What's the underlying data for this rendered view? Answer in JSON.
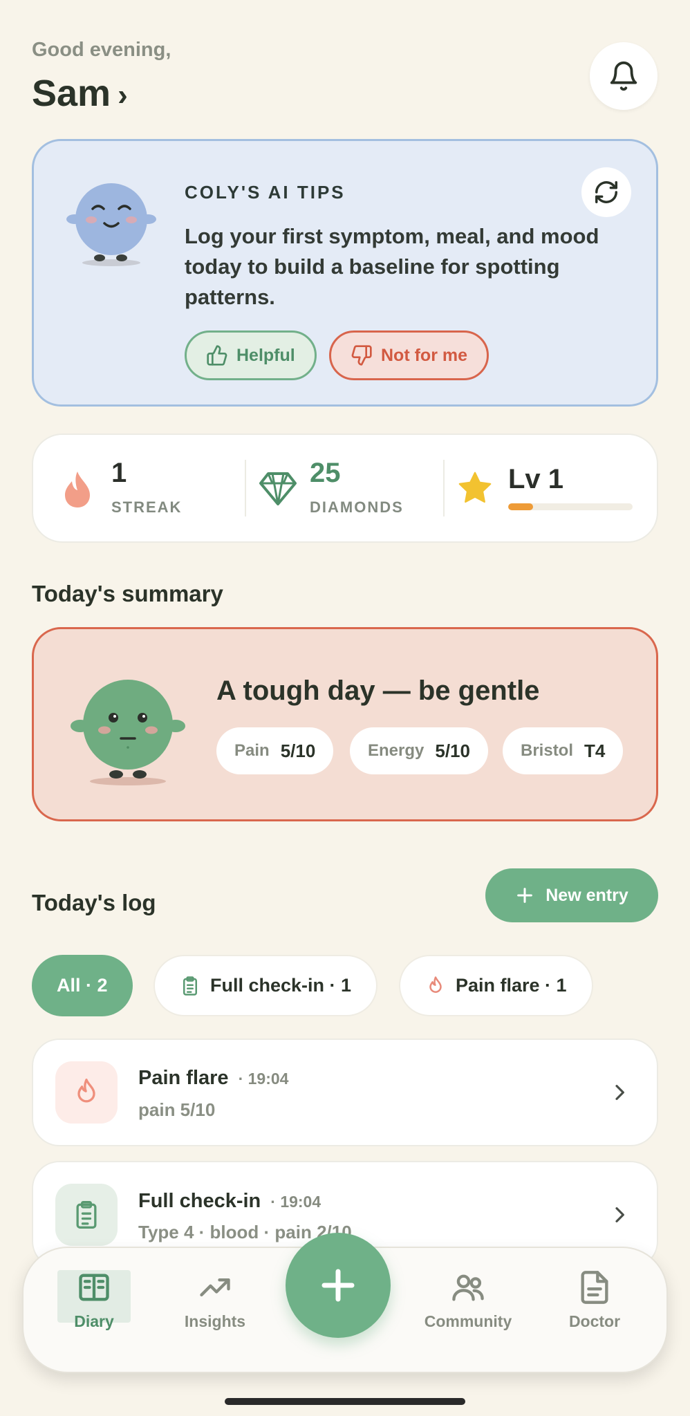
{
  "header": {
    "greeting": "Good evening,",
    "username": "Sam",
    "chevron": "›",
    "notification_icon": "bell-icon"
  },
  "tips": {
    "title": "COLY'S AI TIPS",
    "body": "Log your first symptom, meal, and mood today to build a baseline for spotting patterns.",
    "helpful_label": "Helpful",
    "not_for_me_label": "Not for me",
    "refresh_icon": "refresh-icon",
    "colors": {
      "background": "#e4ebf6",
      "border": "#a3bfe0"
    }
  },
  "stats": {
    "streak": {
      "value": "1",
      "label": "STREAK",
      "icon": "flame-icon"
    },
    "diamonds": {
      "value": "25",
      "label": "DIAMONDS",
      "icon": "diamond-icon",
      "color": "#4e8e68"
    },
    "level": {
      "value": "Lv 1",
      "icon": "star-icon",
      "progress": 0.2
    }
  },
  "summary": {
    "section_title": "Today's summary",
    "headline": "A tough day — be gentle",
    "metrics": [
      {
        "label": "Pain",
        "value": "5/10"
      },
      {
        "label": "Energy",
        "value": "5/10"
      },
      {
        "label": "Bristol",
        "value": "T4"
      }
    ]
  },
  "log": {
    "section_title": "Today's log",
    "new_entry_label": "New entry",
    "filters": [
      {
        "label": "All · 2",
        "active": true
      },
      {
        "label": "Full check-in · 1",
        "icon": "clipboard-icon"
      },
      {
        "label": "Pain flare · 1",
        "icon": "flame-icon"
      }
    ],
    "entries": [
      {
        "title": "Pain flare",
        "time": "· 19:04",
        "subtitle": "pain 5/10",
        "icon": "flame-icon"
      },
      {
        "title": "Full check-in",
        "time": "· 19:04",
        "subtitle": "Type 4 · blood · pain 2/10",
        "icon": "clipboard-icon"
      }
    ]
  },
  "nav": {
    "items": [
      {
        "label": "Diary",
        "icon": "book-icon",
        "active": true
      },
      {
        "label": "Insights",
        "icon": "trend-icon"
      },
      {
        "label": "Community",
        "icon": "people-icon"
      },
      {
        "label": "Doctor",
        "icon": "document-icon"
      }
    ],
    "fab_icon": "plus-icon",
    "accent": "#6fb188"
  }
}
